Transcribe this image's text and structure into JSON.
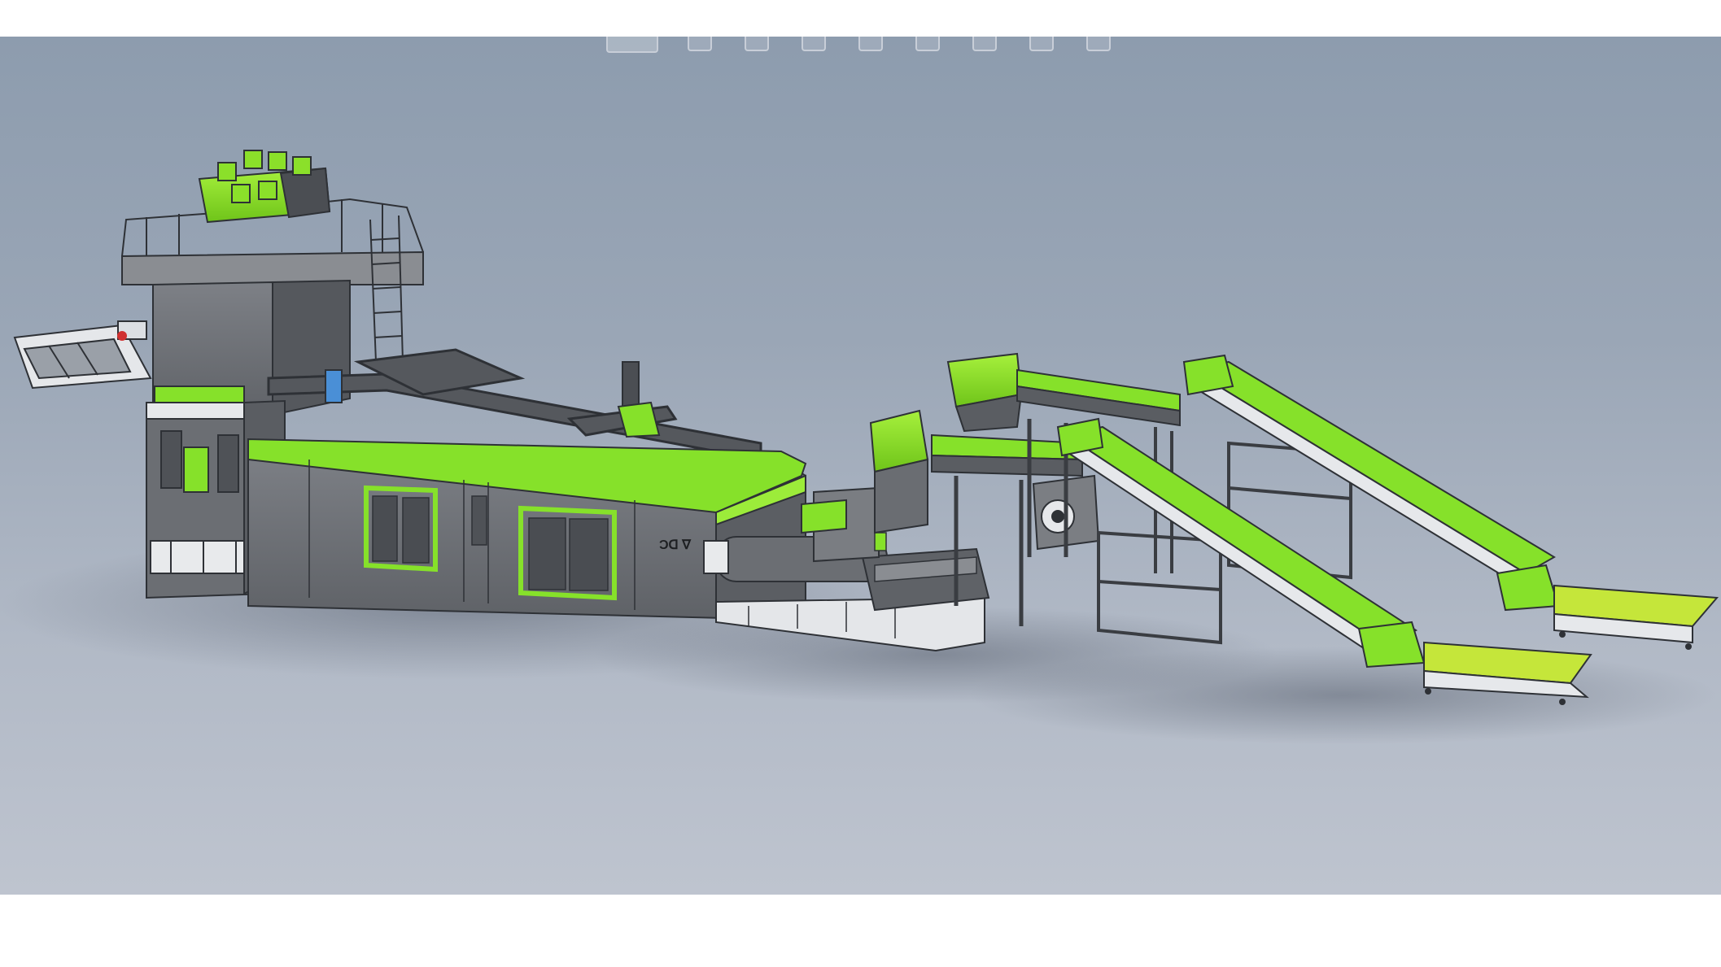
{
  "window": {
    "title": ""
  },
  "viewport": {
    "background_top": "#8d9cae",
    "background_bottom": "#bec4cf",
    "model": {
      "accent_color": "#86e12a",
      "body_color": "#6e7176",
      "frame_color": "#3a3d42",
      "marking": "Ͻᗡ ∇"
    }
  },
  "toolbar": {
    "items": [
      {
        "icon": "view-orientation-icon"
      },
      {
        "icon": "zoom-fit-icon"
      },
      {
        "icon": "zoom-area-icon"
      },
      {
        "icon": "previous-view-icon"
      },
      {
        "icon": "section-view-icon"
      },
      {
        "icon": "display-style-icon"
      },
      {
        "icon": "hide-show-icon"
      },
      {
        "icon": "edit-appearance-icon"
      },
      {
        "icon": "scene-icon"
      }
    ]
  }
}
